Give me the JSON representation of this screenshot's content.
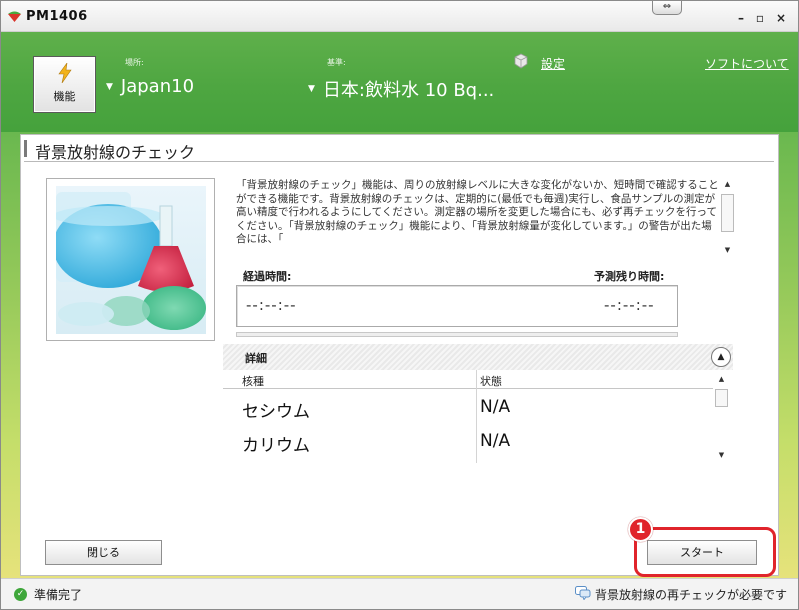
{
  "window": {
    "title": "PM1406",
    "resize_glyph": "⇔",
    "minimize_glyph": "–",
    "maximize_glyph": "▫",
    "close_glyph": "×"
  },
  "header": {
    "function_button_label": "機能",
    "location_label": "場所:",
    "location_value": "Japan10",
    "standard_label": "基準:",
    "standard_value": "日本:飲料水 10 Bq...",
    "settings_link": "設定",
    "about_link": "ソフトについて",
    "caret_glyph": "▼"
  },
  "panel": {
    "title": "背景放射線のチェック",
    "description": "「背景放射線のチェック」機能は、周りの放射線レベルに大きな変化がないか、短時間で確認することができる機能です。背景放射線のチェックは、定期的に(最低でも毎週)実行し、食品サンプルの測定が高い精度で行われるようにしてください。測定器の場所を変更した場合にも、必ず再チェックを行ってください。「背景放射線のチェック」機能により、「背景放射線量が変化しています。」の警告が出た場合には、「",
    "elapsed_label": "経過時間:",
    "elapsed_value": "--:--:--",
    "remaining_label": "予測残り時間:",
    "remaining_value": "--:--:--",
    "details_label": "詳細",
    "collapse_glyph": "▲",
    "table": {
      "columns": [
        "核種",
        "状態"
      ],
      "rows": [
        [
          "セシウム",
          "N/A"
        ],
        [
          "カリウム",
          "N/A"
        ]
      ]
    },
    "close_button": "閉じる",
    "start_button": "スタート",
    "callout_number": "1",
    "scroll_up_glyph": "▲",
    "scroll_down_glyph": "▼"
  },
  "status": {
    "left": "準備完了",
    "right": "背景放射線の再チェックが必要です",
    "ok_glyph": "✓"
  },
  "colors": {
    "header_green": "#4ea641",
    "callout_red": "#e0242b"
  },
  "icons": [
    "app-icon",
    "lightning-icon",
    "gear-icon",
    "check-icon",
    "speech-bubble-icon"
  ]
}
